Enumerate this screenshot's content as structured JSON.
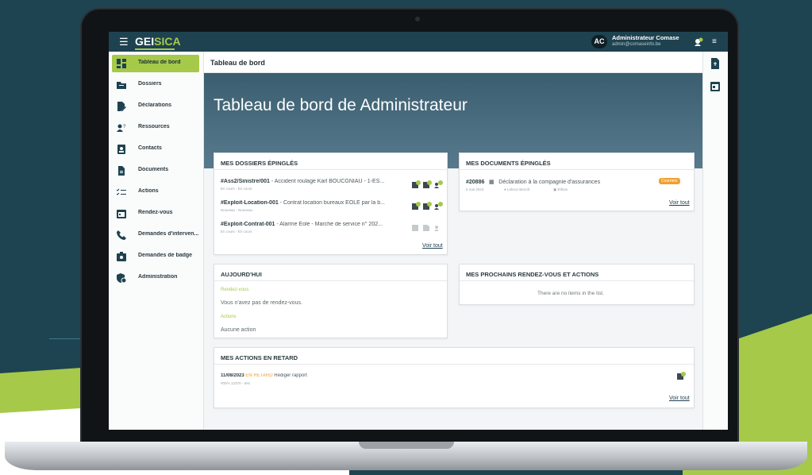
{
  "colors": {
    "accent": "#a6c94a",
    "topbar": "#1e4250",
    "late": "#f0a030",
    "bg": "#1d4450"
  },
  "app": {
    "logo_a": "GEI",
    "logo_b": "SICA",
    "menu_icon": "hamburger-icon"
  },
  "user": {
    "initials": "AC",
    "name": "Administrateur Comase",
    "email": "admin@comaseinfo.be"
  },
  "sidebar": {
    "items": [
      {
        "label": "Tableau de bord",
        "icon": "dashboard-icon",
        "active": true
      },
      {
        "label": "Dossiers",
        "icon": "folder-icon"
      },
      {
        "label": "Déclarations",
        "icon": "file-edit-icon"
      },
      {
        "label": "Ressources",
        "icon": "users-icon"
      },
      {
        "label": "Contacts",
        "icon": "contact-card-icon"
      },
      {
        "label": "Documents",
        "icon": "document-icon"
      },
      {
        "label": "Actions",
        "icon": "checklist-icon"
      },
      {
        "label": "Rendez-vous",
        "icon": "calendar-icon"
      },
      {
        "label": "Demandes d'interven...",
        "icon": "phone-icon"
      },
      {
        "label": "Demandes de badge",
        "icon": "badge-icon"
      },
      {
        "label": "Administration",
        "icon": "shield-gear-icon"
      }
    ]
  },
  "header": {
    "breadcrumb": "Tableau de bord",
    "title": "Tableau de bord de Administrateur"
  },
  "pinned_files": {
    "title": "MES DOSSIERS ÉPINGLÉS",
    "rows": [
      {
        "ref": "#Ass2/Sinistre/001",
        "desc": " - Accident roulage Karl BOUCGNIAU - 1-ES...",
        "status": "En cours - En cours",
        "active": true
      },
      {
        "ref": "#Exploit-Location-001",
        "desc": " - Contrat location bureaux EOLE par la b...",
        "status": "Nouveau - Nouveau",
        "active": true
      },
      {
        "ref": "#Exploit-Contrat-001",
        "desc": " - Alarme Eole - Marché de service n° 202...",
        "status": "En cours - En cours",
        "active": false
      }
    ],
    "link": "Voir tout"
  },
  "pinned_docs": {
    "title": "MES DOCUMENTS ÉPINGLÉS",
    "ref": "#20886",
    "desc": "Déclaration à la compagnie d'assurances",
    "badge": "Courriers",
    "date": "5 mai 2023",
    "person": "Lebrun Benoît",
    "org": "Ethias",
    "link": "Voir tout"
  },
  "today": {
    "title": "AUJOURD'HUI",
    "meetings_label": "Rendez-vous",
    "meetings_empty": "Vous n'avez pas de rendez-vous.",
    "actions_label": "Actions",
    "actions_empty": "Aucune action"
  },
  "upcoming": {
    "title": "MES PROCHAINS RENDEZ-VOUS ET ACTIONS",
    "empty": "There are no items in the list."
  },
  "late": {
    "title": "MES ACTIONS EN RETARD",
    "date": "11/08/2023",
    "status": "EN RETARD",
    "action": "Rédiger rapport",
    "sub": "#00/A.12370 - test",
    "link": "Voir tout"
  }
}
